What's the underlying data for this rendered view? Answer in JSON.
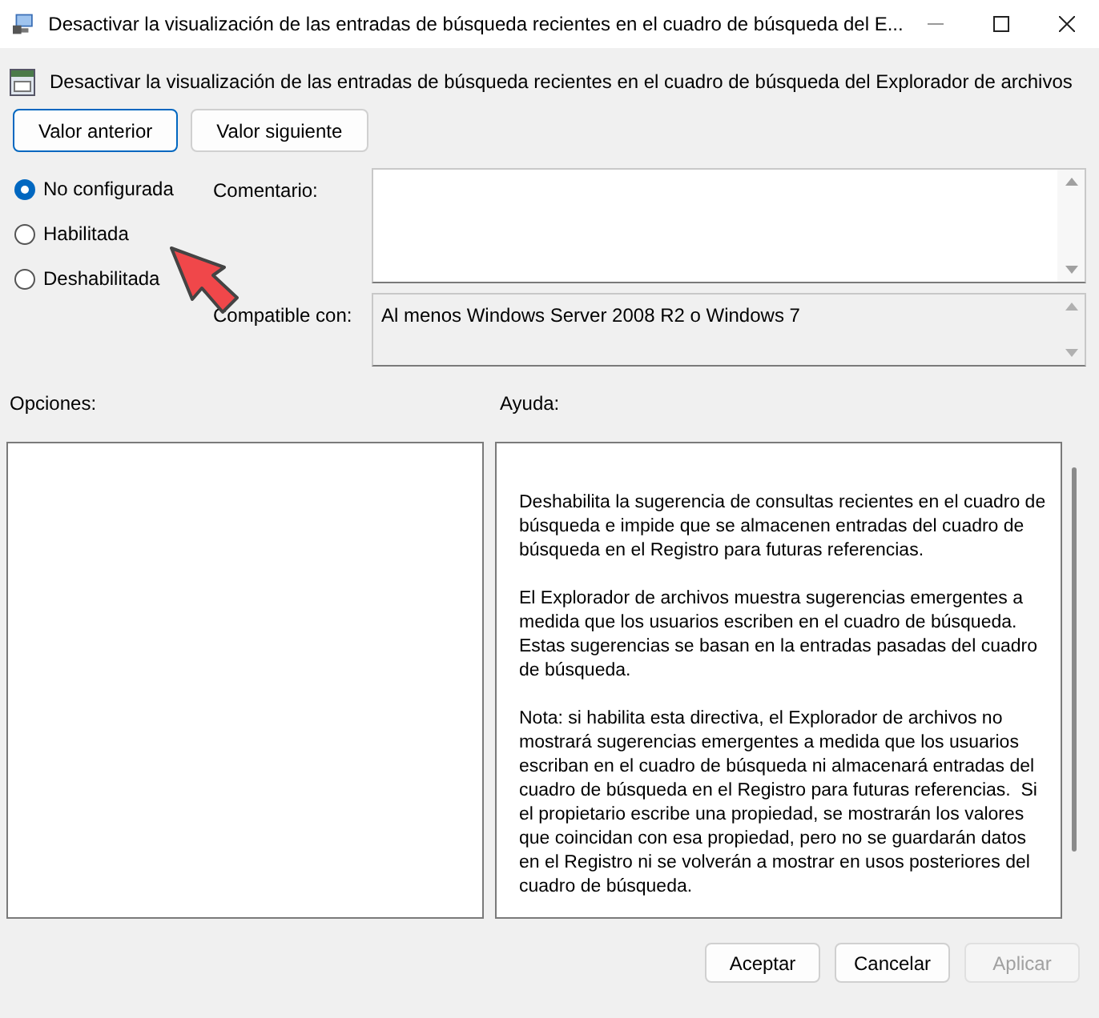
{
  "window": {
    "title": "Desactivar la visualización de las entradas de búsqueda recientes en el cuadro de búsqueda del E..."
  },
  "header": {
    "title": "Desactivar la visualización de las entradas de búsqueda recientes en el cuadro de búsqueda del Explorador de archivos"
  },
  "nav_buttons": [
    {
      "label": "Valor anterior",
      "focused": true
    },
    {
      "label": "Valor siguiente",
      "focused": false
    }
  ],
  "options": [
    {
      "label": "No configurada",
      "selected": true
    },
    {
      "label": "Habilitada",
      "selected": false
    },
    {
      "label": "Deshabilitada",
      "selected": false
    }
  ],
  "comment": {
    "label": "Comentario:"
  },
  "compatible": {
    "label": "Compatible con:",
    "value": "Al menos Windows Server 2008 R2 o Windows 7"
  },
  "options_label": "Opciones:",
  "help": {
    "label": "Ayuda:",
    "paragraphs": [
      "Deshabilita la sugerencia de consultas recientes en el cuadro de búsqueda e impide que se almacenen entradas del cuadro de búsqueda en el Registro para futuras referencias.",
      "El Explorador de archivos muestra sugerencias emergentes a medida que los usuarios escriben en el cuadro de búsqueda. Estas sugerencias se basan en la entradas pasadas del cuadro de búsqueda.",
      "Nota: si habilita esta directiva, el Explorador de archivos no mostrará sugerencias emergentes a medida que los usuarios escriban en el cuadro de búsqueda ni almacenará entradas del cuadro de búsqueda en el Registro para futuras referencias.  Si el propietario escribe una propiedad, se mostrarán los valores que coincidan con esa propiedad, pero no se guardarán datos en el Registro ni se volverán a mostrar en usos posteriores del cuadro de búsqueda."
    ]
  },
  "buttons": [
    {
      "label": "Aceptar",
      "disabled": false
    },
    {
      "label": "Cancelar",
      "disabled": false
    },
    {
      "label": "Aplicar",
      "disabled": true
    }
  ]
}
